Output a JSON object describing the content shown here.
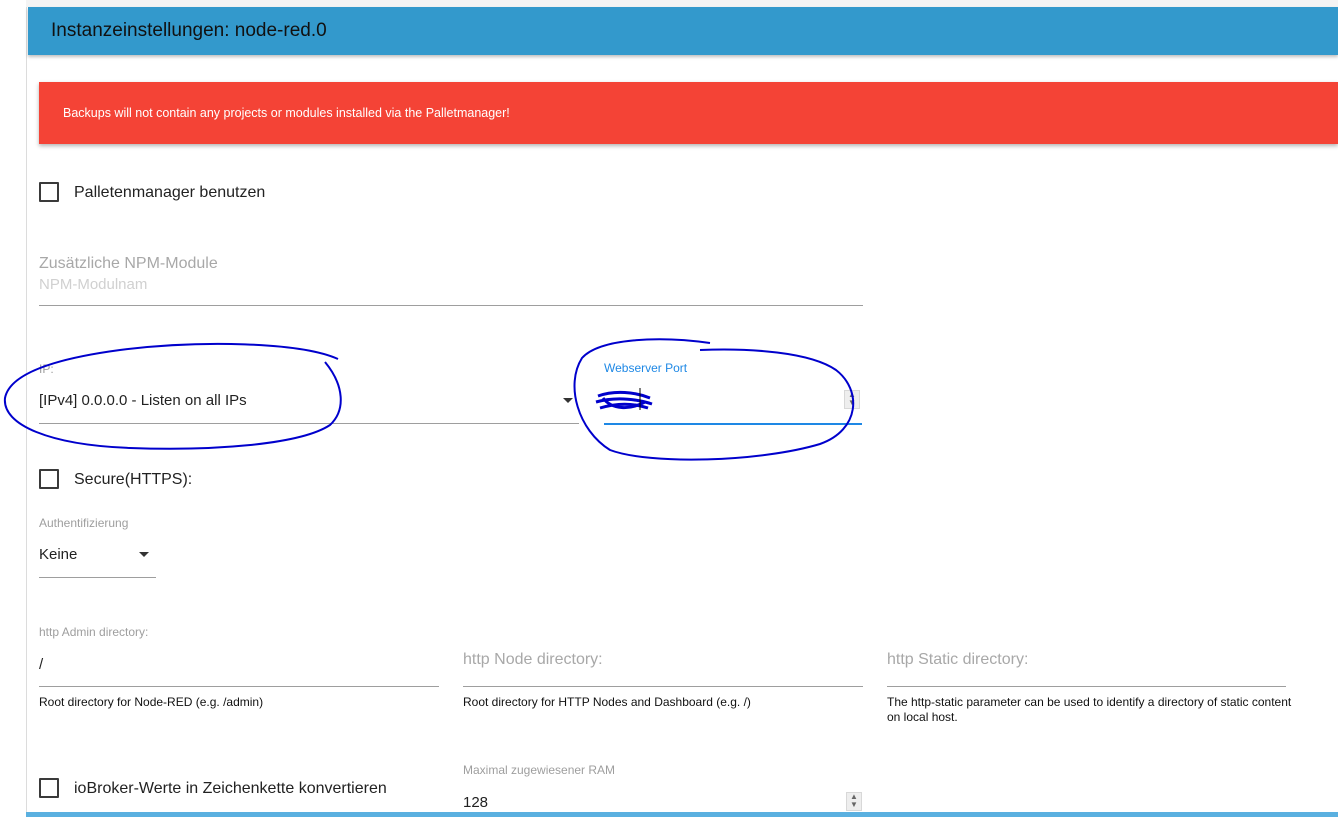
{
  "header": {
    "title": "Instanzeinstellungen: node-red.0"
  },
  "alert": {
    "message": "Backups will not contain any projects or modules installed via the Palletmanager!"
  },
  "palette_manager": {
    "label": "Palletenmanager benutzen",
    "checked": false
  },
  "npm_modules": {
    "label": "Zusätzliche NPM-Module",
    "placeholder": "NPM-Modulnam"
  },
  "ip": {
    "label": "IP:",
    "value": "[IPv4] 0.0.0.0 - Listen on all IPs"
  },
  "webserver_port": {
    "label": "Webserver Port",
    "value": ""
  },
  "secure": {
    "label": "Secure(HTTPS):",
    "checked": false
  },
  "auth": {
    "label": "Authentifizierung",
    "value": "Keine"
  },
  "http_admin": {
    "label": "http Admin directory:",
    "value": "/",
    "helper": "Root directory for Node-RED (e.g. /admin)"
  },
  "http_node": {
    "label": "http Node directory:",
    "value": "",
    "helper": "Root directory for HTTP Nodes and Dashboard (e.g. /)"
  },
  "http_static": {
    "label": "http Static directory:",
    "value": "",
    "helper": "The http-static parameter can be used to identify a directory of static content on local host."
  },
  "convert_values": {
    "label": "ioBroker-Werte in Zeichenkette konvertieren",
    "checked": false
  },
  "max_ram": {
    "label": "Maximal zugewiesener RAM",
    "value": "128"
  },
  "colors": {
    "header": "#3399cc",
    "alert": "#f44336",
    "focus": "#1e88e5",
    "annotation": "#0000cc"
  }
}
